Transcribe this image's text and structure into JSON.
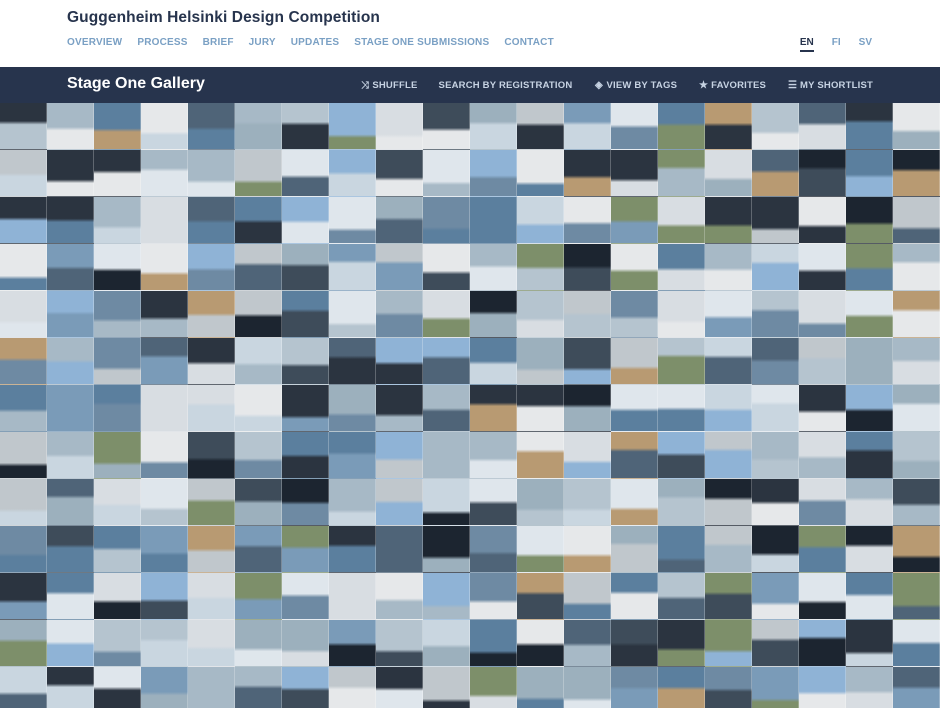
{
  "header": {
    "title": "Guggenheim Helsinki Design Competition",
    "nav": [
      "OVERVIEW",
      "PROCESS",
      "BRIEF",
      "JURY",
      "UPDATES",
      "STAGE ONE SUBMISSIONS",
      "CONTACT"
    ],
    "languages": [
      "EN",
      "FI",
      "SV"
    ],
    "active_language": "EN"
  },
  "gallery_bar": {
    "title": "Stage One Gallery",
    "tools": [
      {
        "icon": "shuffle-icon",
        "label": "SHUFFLE"
      },
      {
        "icon": "none",
        "label": "SEARCH BY REGISTRATION"
      },
      {
        "icon": "tag-icon",
        "label": "VIEW BY TAGS"
      },
      {
        "icon": "star-icon",
        "label": "FAVORITES"
      },
      {
        "icon": "list-icon",
        "label": "MY SHORTLIST"
      }
    ]
  },
  "gallery": {
    "columns": 20,
    "rows": 13,
    "palette": [
      "#8fb3d6",
      "#5b7f9e",
      "#d8dde2",
      "#3e4c5a",
      "#a7b9c6",
      "#c9d6e0",
      "#6e8aa3",
      "#e6e8ea",
      "#2b3440",
      "#7a9bb8",
      "#b5c4cf",
      "#4f6478",
      "#9cb0bd",
      "#dfe6ec",
      "#1c2530",
      "#b89a72",
      "#7d8f6a",
      "#c0c7cc"
    ]
  }
}
